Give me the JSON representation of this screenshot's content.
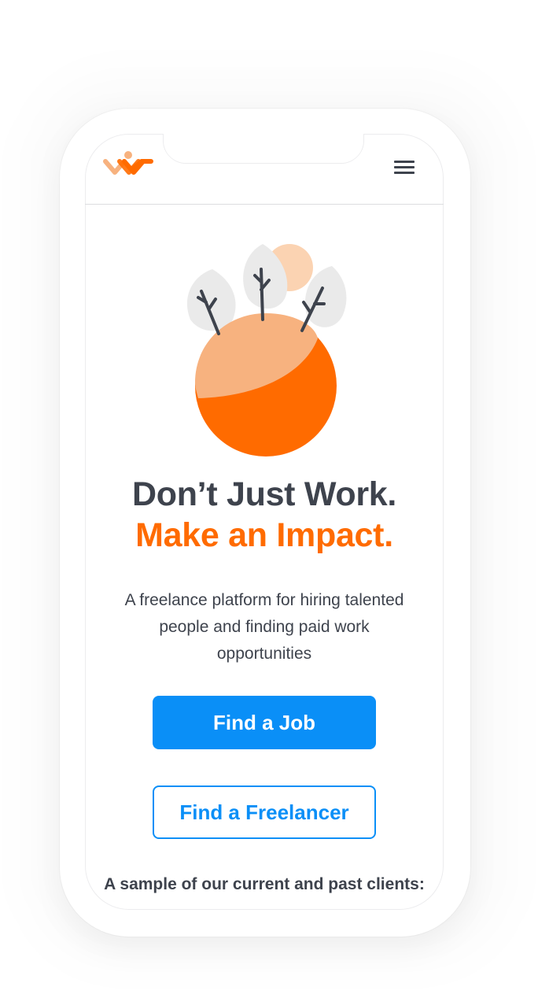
{
  "brand": {
    "logo_icon": "brand-logo-icon",
    "accent_color": "#ff6b00",
    "primary_color": "#0a8ff7",
    "text_color": "#3e434d"
  },
  "header": {
    "menu_icon": "hamburger-menu-icon"
  },
  "hero": {
    "illustration": "planet-with-trees-icon",
    "headline_line1": "Don’t Just Work.",
    "headline_line2": "Make an Impact.",
    "subtitle": "A freelance platform for hiring talented people and finding paid work opportunities"
  },
  "actions": {
    "find_job_label": "Find a Job",
    "find_freelancer_label": "Find a Freelancer"
  },
  "clients": {
    "heading": "A sample of our current and past clients:"
  }
}
